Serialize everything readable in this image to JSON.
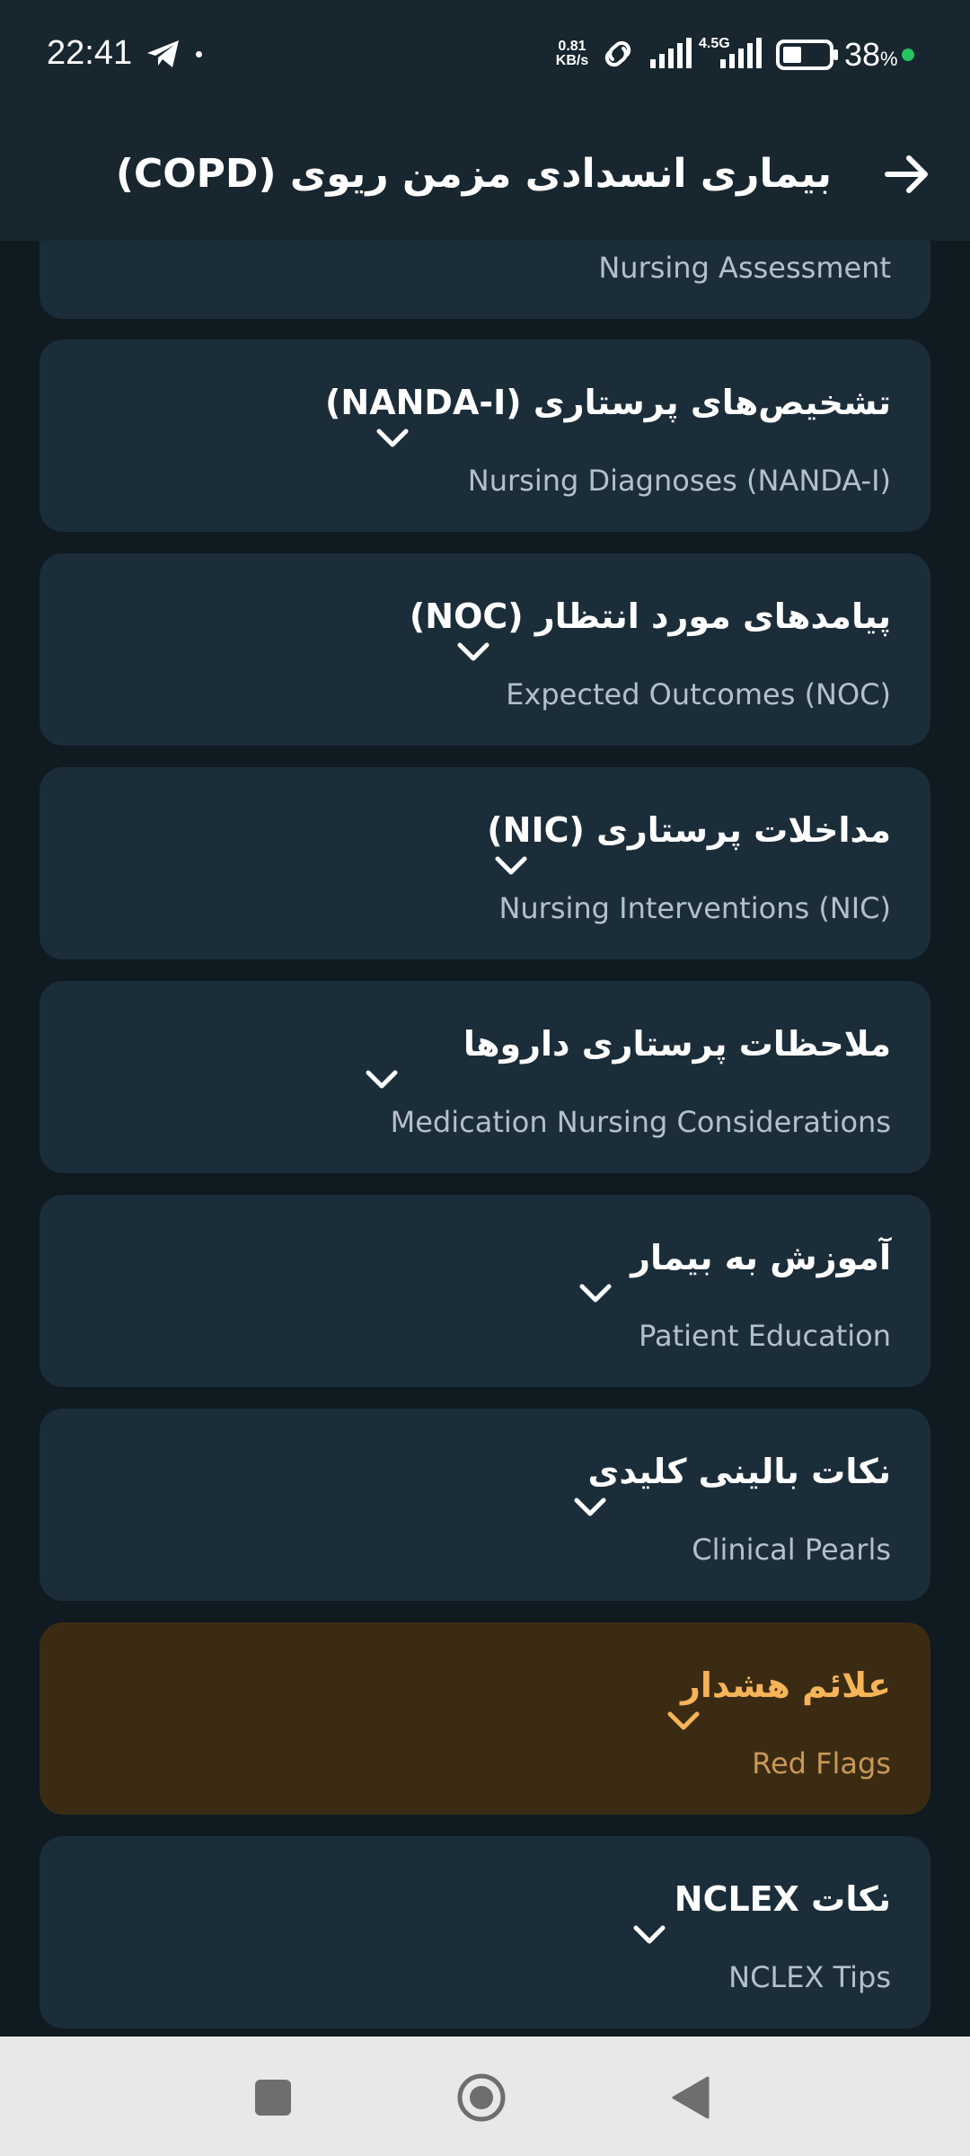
{
  "status_bar": {
    "time": "22:41",
    "speed_value": "0.81",
    "speed_unit": "KB/s",
    "network": "4.5G",
    "battery_level": "38",
    "battery_percent_sign": "%"
  },
  "header": {
    "title": "بیماری انسدادی مزمن ریوی (COPD)",
    "back_icon": "arrow-right-icon"
  },
  "sections": [
    {
      "title": "",
      "subtitle": "Nursing Assessment"
    },
    {
      "title": "تشخیص‌های پرستاری (NANDA-I)",
      "subtitle": "Nursing Diagnoses (NANDA-I)"
    },
    {
      "title": "پیامدهای مورد انتظار (NOC)",
      "subtitle": "Expected Outcomes (NOC)"
    },
    {
      "title": "مداخلات پرستاری (NIC)",
      "subtitle": "Nursing Interventions (NIC)"
    },
    {
      "title": "ملاحظات پرستاری داروها",
      "subtitle": "Medication Nursing Considerations"
    },
    {
      "title": "آموزش به بیمار",
      "subtitle": "Patient Education"
    },
    {
      "title": "نکات بالینی کلیدی",
      "subtitle": "Clinical Pearls"
    },
    {
      "title": "علائم هشدار",
      "subtitle": "Red Flags"
    },
    {
      "title": "نکات NCLEX",
      "subtitle": "NCLEX Tips"
    }
  ],
  "colors": {
    "background": "#0f1a21",
    "card": "#1c2d3a",
    "warning_card": "#3b2b13",
    "warning_text": "#f6b458"
  },
  "navigation": {
    "recent_icon": "square-icon",
    "home_icon": "circle-icon",
    "back_icon": "triangle-back-icon"
  }
}
